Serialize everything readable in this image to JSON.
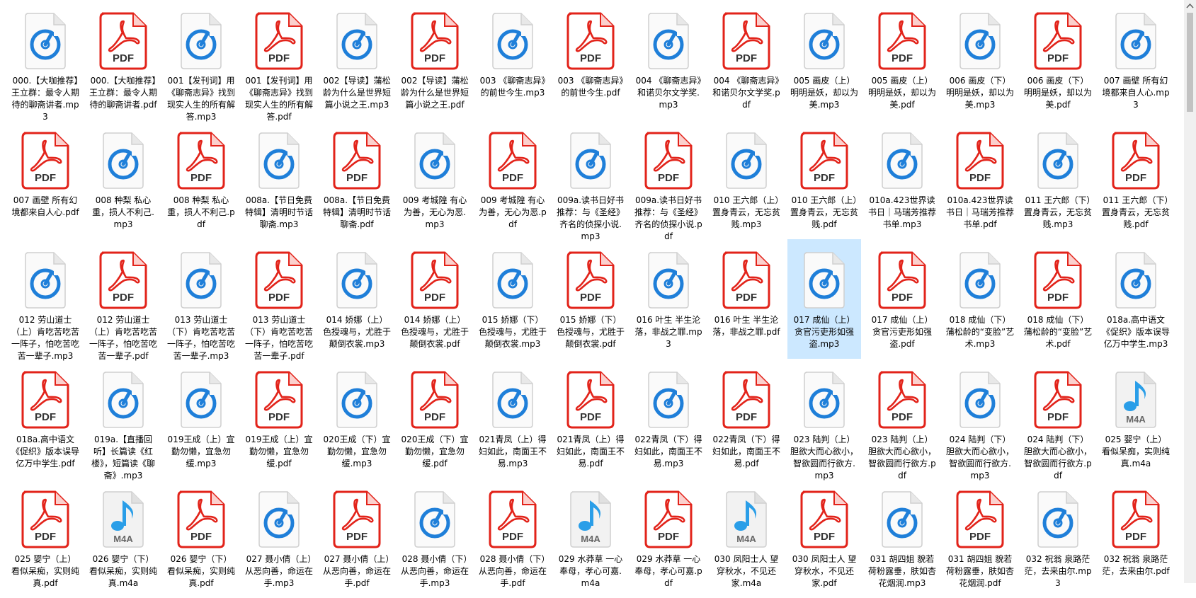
{
  "window": {
    "selected_index": 40
  },
  "items": [
    {
      "name": "000.【大咖推荐】王立群：最令人期待的聊斋讲者.mp3",
      "type": "mp3"
    },
    {
      "name": "000.【大咖推荐】王立群：最令人期待的聊斋讲者.pdf",
      "type": "pdf"
    },
    {
      "name": "001【发刊词】用《聊斋志异》找到现实人生的所有解答.mp3",
      "type": "mp3"
    },
    {
      "name": "001【发刊词】用《聊斋志异》找到现实人生的所有解答.pdf",
      "type": "pdf"
    },
    {
      "name": "002【导读】蒲松龄为什么是世界短篇小说之王.mp3",
      "type": "mp3"
    },
    {
      "name": "002【导读】蒲松龄为什么是世界短篇小说之王.pdf",
      "type": "pdf"
    },
    {
      "name": "003 《聊斋志异》的前世今生.mp3",
      "type": "mp3"
    },
    {
      "name": "003 《聊斋志异》的前世今生.pdf",
      "type": "pdf"
    },
    {
      "name": "004 《聊斋志异》和诺贝尔文学奖.mp3",
      "type": "mp3"
    },
    {
      "name": "004 《聊斋志异》和诺贝尔文学奖.pdf",
      "type": "pdf"
    },
    {
      "name": "005 画皮（上）明明是妖，却以为美.mp3",
      "type": "mp3"
    },
    {
      "name": "005 画皮（上）明明是妖，却以为美.pdf",
      "type": "pdf"
    },
    {
      "name": "006 画皮（下）明明是妖，却以为美.mp3",
      "type": "mp3"
    },
    {
      "name": "006 画皮（下）明明是妖，却以为美.pdf",
      "type": "pdf"
    },
    {
      "name": "007 画壁 所有幻境都来自人心.mp3",
      "type": "mp3"
    },
    {
      "name": "007 画壁 所有幻境都来自人心.pdf",
      "type": "pdf"
    },
    {
      "name": "008 种梨 私心重，损人不利己.mp3",
      "type": "mp3"
    },
    {
      "name": "008 种梨 私心重，损人不利己.pdf",
      "type": "pdf"
    },
    {
      "name": "008a.【节日免费特辑】清明时节话聊斋.mp3",
      "type": "mp3"
    },
    {
      "name": "008a.【节日免费特辑】清明时节话聊斋.pdf",
      "type": "pdf"
    },
    {
      "name": "009 考城隍 有心为善，无心为恶.mp3",
      "type": "mp3"
    },
    {
      "name": "009 考城隍 有心为善，无心为恶.pdf",
      "type": "pdf"
    },
    {
      "name": "009a.读书日好书推荐：与《圣经》齐名的侦探小说.mp3",
      "type": "mp3"
    },
    {
      "name": "009a.读书日好书推荐：与《圣经》齐名的侦探小说.pdf",
      "type": "pdf"
    },
    {
      "name": "010 王六郎（上）置身青云，无忘贫贱.mp3",
      "type": "mp3"
    },
    {
      "name": "010 王六郎（上）置身青云，无忘贫贱.pdf",
      "type": "pdf"
    },
    {
      "name": "010a.423世界读书日｜马瑞芳推荐书单.mp3",
      "type": "mp3"
    },
    {
      "name": "010a.423世界读书日｜马瑞芳推荐书单.pdf",
      "type": "pdf"
    },
    {
      "name": "011 王六郎（下）置身青云，无忘贫贱.mp3",
      "type": "mp3"
    },
    {
      "name": "011 王六郎（下）置身青云，无忘贫贱.pdf",
      "type": "pdf"
    },
    {
      "name": "012 劳山道士（上）肯吃苦吃苦一阵子，怕吃苦吃苦一辈子.mp3",
      "type": "mp3"
    },
    {
      "name": "012 劳山道士（上）肯吃苦吃苦一阵子，怕吃苦吃苦一辈子.pdf",
      "type": "pdf"
    },
    {
      "name": "013 劳山道士（下）肯吃苦吃苦一阵子，怕吃苦吃苦一辈子.mp3",
      "type": "mp3"
    },
    {
      "name": "013 劳山道士（下）肯吃苦吃苦一阵子，怕吃苦吃苦一辈子.pdf",
      "type": "pdf"
    },
    {
      "name": "014 娇娜（上）色授魂与，尤胜于颠倒衣裳.mp3",
      "type": "mp3"
    },
    {
      "name": "014 娇娜（上）色授魂与，尤胜于颠倒衣裳.pdf",
      "type": "pdf"
    },
    {
      "name": "015 娇娜（下）色授魂与，尤胜于颠倒衣裳.mp3",
      "type": "mp3"
    },
    {
      "name": "015 娇娜（下）色授魂与，尤胜于颠倒衣裳.pdf",
      "type": "pdf"
    },
    {
      "name": "016 叶生 半生沦落，非战之罪.mp3",
      "type": "mp3"
    },
    {
      "name": "016 叶生 半生沦落，非战之罪.pdf",
      "type": "pdf"
    },
    {
      "name": "017 成仙（上）贪官污吏形如强盗.mp3",
      "type": "mp3"
    },
    {
      "name": "017 成仙（上）贪官污吏形如强盗.pdf",
      "type": "pdf"
    },
    {
      "name": "018 成仙（下）蒲松龄的“变脸”艺术.mp3",
      "type": "mp3"
    },
    {
      "name": "018 成仙（下）蒲松龄的“变脸”艺术.pdf",
      "type": "pdf"
    },
    {
      "name": "018a.高中语文《促织》版本误导亿万中学生.mp3",
      "type": "mp3"
    },
    {
      "name": "018a.高中语文《促织》版本误导亿万中学生.pdf",
      "type": "pdf"
    },
    {
      "name": "019a.【直播回听】长篇读《红楼》，短篇读《聊斋》.mp3",
      "type": "mp3"
    },
    {
      "name": "019王成（上）宜勤勿懒，宜急勿缓.mp3",
      "type": "mp3"
    },
    {
      "name": "019王成（上）宜勤勿懒，宜急勿缓.pdf",
      "type": "pdf"
    },
    {
      "name": "020王成（下）宜勤勿懒，宜急勿缓.mp3",
      "type": "mp3"
    },
    {
      "name": "020王成（下）宜勤勿懒，宜急勿缓.pdf",
      "type": "pdf"
    },
    {
      "name": "021青凤（上）得妇如此，南面王不易.mp3",
      "type": "mp3"
    },
    {
      "name": "021青凤（上）得妇如此，南面王不易.pdf",
      "type": "pdf"
    },
    {
      "name": "022青凤（下）得妇如此，南面王不易.mp3",
      "type": "mp3"
    },
    {
      "name": "022青凤（下）得妇如此，南面王不易.pdf",
      "type": "pdf"
    },
    {
      "name": "023 陆判（上）胆欲大而心欲小，智欲圆而行欲方.mp3",
      "type": "mp3"
    },
    {
      "name": "023 陆判（上）胆欲大而心欲小，智欲圆而行欲方.pdf",
      "type": "pdf"
    },
    {
      "name": "024 陆判（下）胆欲大而心欲小，智欲圆而行欲方.mp3",
      "type": "mp3"
    },
    {
      "name": "024 陆判（下）胆欲大而心欲小，智欲圆而行欲方.pdf",
      "type": "pdf"
    },
    {
      "name": "025 婴宁（上）看似呆痴，实则纯真.m4a",
      "type": "m4a"
    },
    {
      "name": "025 婴宁（上）看似呆痴，实则纯真.pdf",
      "type": "pdf"
    },
    {
      "name": "026 婴宁（下）看似呆痴，实则纯真.m4a",
      "type": "m4a"
    },
    {
      "name": "026 婴宁（下）看似呆痴，实则纯真.pdf",
      "type": "pdf"
    },
    {
      "name": "027 聂小倩（上）从恶向善，命运在手.mp3",
      "type": "mp3"
    },
    {
      "name": "027 聂小倩（上）从恶向善，命运在手.pdf",
      "type": "pdf"
    },
    {
      "name": "028 聂小倩（下）从恶向善，命运在手.mp3",
      "type": "mp3"
    },
    {
      "name": "028 聂小倩（下）从恶向善，命运在手.pdf",
      "type": "pdf"
    },
    {
      "name": "029 水莽草 一心奉母，孝心可嘉.m4a",
      "type": "m4a"
    },
    {
      "name": "029 水莽草 一心奉母，孝心可嘉.pdf",
      "type": "pdf"
    },
    {
      "name": "030 凤阳士人 望穿秋水，不见还家.m4a",
      "type": "m4a"
    },
    {
      "name": "030 凤阳士人 望穿秋水，不见还家.pdf",
      "type": "pdf"
    },
    {
      "name": "031 胡四姐 貌若荷粉露垂，肤如杏花烟润.mp3",
      "type": "mp3"
    },
    {
      "name": "031 胡四姐 貌若荷粉露垂，肤如杏花烟润.pdf",
      "type": "pdf"
    },
    {
      "name": "032 祝翁 泉路茫茫，去来由尔.mp3",
      "type": "mp3"
    },
    {
      "name": "032 祝翁 泉路茫茫，去来由尔.pdf",
      "type": "pdf"
    }
  ],
  "icons": {
    "pdf_text": "PDF",
    "m4a_text": "M4A",
    "colors": {
      "pdf_red": "#e2231a",
      "audio_blue": "#1f7fd9",
      "selected_bg": "#cce8ff"
    }
  }
}
